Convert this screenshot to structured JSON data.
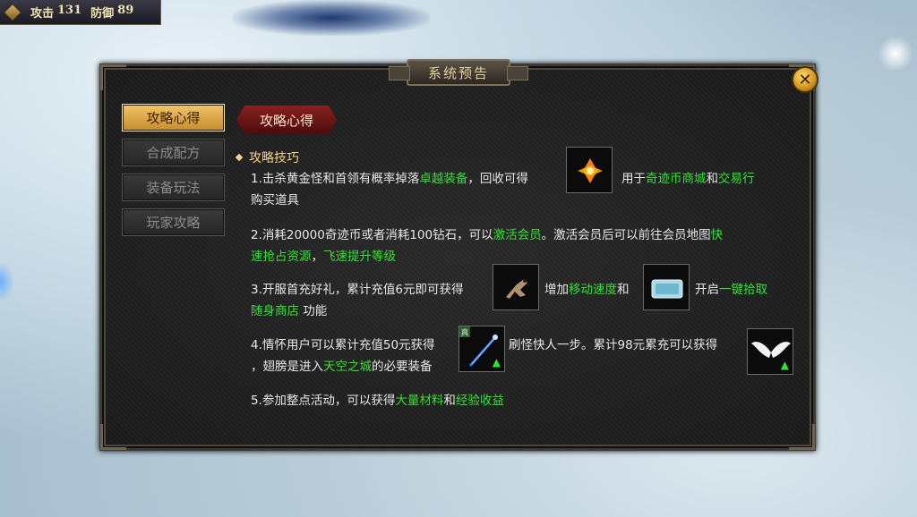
{
  "hud": {
    "attack_label": "攻击",
    "attack_value": "131",
    "defense_label": "防御",
    "defense_value": "89"
  },
  "panel": {
    "title": "系统预告",
    "close_icon": "close-icon"
  },
  "tabs": [
    {
      "label": "攻略心得",
      "active": true
    },
    {
      "label": "合成配方",
      "active": false
    },
    {
      "label": "装备玩法",
      "active": false
    },
    {
      "label": "玩家攻略",
      "active": false
    }
  ],
  "content": {
    "header": "攻略心得",
    "section_title": "攻略技巧",
    "p1": {
      "a": "1.击杀黄金怪和首领有概率掉落",
      "b": "卓越装备",
      "c": "，回收可得",
      "d": "用于",
      "e": "奇迹币商城",
      "f": "和",
      "g": "交易行",
      "h": "购买道具"
    },
    "p2": {
      "a": "2.消耗20000奇迹币或者消耗100钻石，可以",
      "b": "激活会员",
      "c": "。激活会员后可以前往会员地图",
      "d": "快",
      "e": "速抢占资源",
      "f": "，",
      "g": "飞速提升等级"
    },
    "p3": {
      "a": "3.开服首充好礼，累计充值6元即可获得",
      "b": "增加",
      "c": "移动速度",
      "d": "和",
      "e": "开启",
      "f": "一键拾取",
      "g": "随身商店",
      "h": " 功能"
    },
    "p4": {
      "a": "4.情怀用户可以累计充值50元获得",
      "b": "刷怪快人一步。累计98元累充可以获得",
      "c": "，翅膀是进入",
      "d": "天空之城",
      "e": "的必要装备"
    },
    "p5": {
      "a": "5.参加整点活动，可以获得",
      "b": "大量材料",
      "c": "和",
      "d": "经验收益"
    },
    "item_badge": "真"
  }
}
